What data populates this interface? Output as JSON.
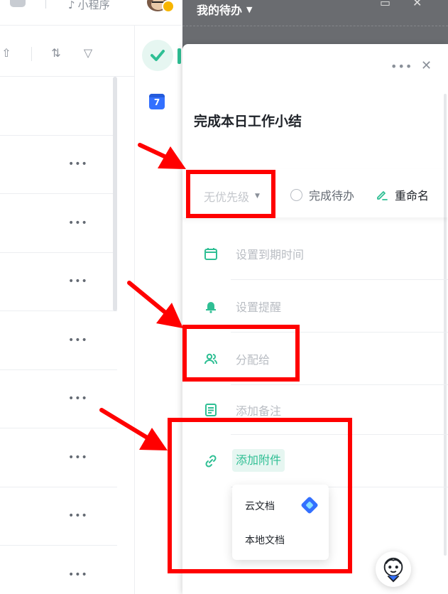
{
  "topbar": {
    "mini_program_label": "小程序"
  },
  "overlay": {
    "header_title": "我的待办"
  },
  "list": {
    "rows": [
      "",
      "",
      "",
      "",
      "",
      "",
      "",
      "",
      ""
    ]
  },
  "panel": {
    "task_title": "完成本日工作小结",
    "priority_placeholder": "无优先级",
    "complete_label": "完成待办",
    "rename_label": "重命名",
    "fields": {
      "due": "设置到期时间",
      "reminder": "设置提醒",
      "assign": "分配给",
      "note": "添加备注",
      "attachment": "添加附件"
    },
    "attachment_menu": {
      "cloud_doc": "云文档",
      "local_doc": "本地文档"
    }
  },
  "colors": {
    "accent": "#2fbf94",
    "annotation": "#ff0000",
    "overlay": "#6a6c70"
  },
  "rail": {
    "calendar_day": "7"
  }
}
